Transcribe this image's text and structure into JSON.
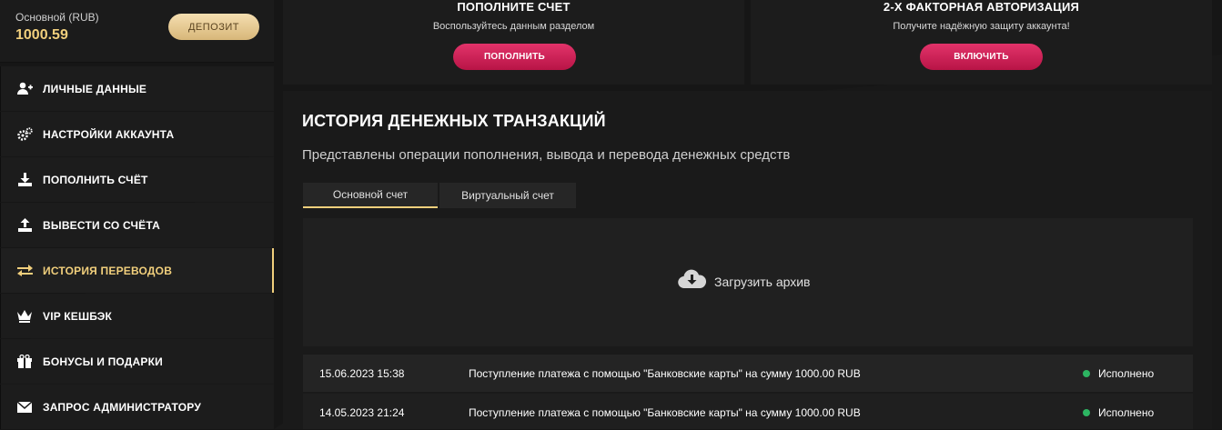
{
  "balance": {
    "label": "Основной (RUB)",
    "value": "1000.59",
    "deposit_label": "ДЕПОЗИТ"
  },
  "menu": [
    {
      "label": "ЛИЧНЫЕ ДАННЫЕ",
      "icon": "user-plus-icon",
      "active": false
    },
    {
      "label": "НАСТРОЙКИ АККАУНТА",
      "icon": "gears-icon",
      "active": false
    },
    {
      "label": "ПОПОЛНИТЬ СЧЁТ",
      "icon": "download-icon",
      "active": false
    },
    {
      "label": "ВЫВЕСТИ СО СЧЁТА",
      "icon": "upload-icon",
      "active": false
    },
    {
      "label": "ИСТОРИЯ ПЕРЕВОДОВ",
      "icon": "exchange-arrows-icon",
      "active": true
    },
    {
      "label": "VIP КЕШБЭК",
      "icon": "crown-icon",
      "active": false
    },
    {
      "label": "БОНУСЫ И ПОДАРКИ",
      "icon": "gift-icon",
      "active": false
    },
    {
      "label": "ЗАПРОС АДМИНИСТРАТОРУ",
      "icon": "envelope-icon",
      "active": false
    }
  ],
  "cards": {
    "topup": {
      "title": "ПОПОЛНИТЕ СЧЕТ",
      "subtitle": "Воспользуйтесь данным разделом",
      "button": "ПОПОЛНИТЬ"
    },
    "twofa": {
      "title": "2-Х ФАКТОРНАЯ АВТОРИЗАЦИЯ",
      "subtitle": "Получите надёжную защиту аккаунта!",
      "button": "ВКЛЮЧИТЬ"
    }
  },
  "history": {
    "title": "ИСТОРИЯ ДЕНЕЖНЫХ ТРАНЗАКЦИЙ",
    "subtitle": "Представлены операции пополнения, вывода и перевода денежных средств",
    "tabs": [
      {
        "label": "Основной счет",
        "active": true
      },
      {
        "label": "Виртуальный счет",
        "active": false
      }
    ],
    "archive_label": "Загрузить архив",
    "rows": [
      {
        "date": "15.06.2023 15:38",
        "description": "Поступление платежа с помощью \"Банковские карты\" на сумму 1000.00 RUB",
        "status": "Исполнено"
      },
      {
        "date": "14.05.2023 21:24",
        "description": "Поступление платежа с помощью \"Банковские карты\" на сумму 1000.00 RUB",
        "status": "Исполнено"
      }
    ]
  },
  "colors": {
    "accent_gold": "#f1cf7c",
    "accent_pink": "#d0235a",
    "status_green": "#2db562",
    "background": "#161616"
  }
}
